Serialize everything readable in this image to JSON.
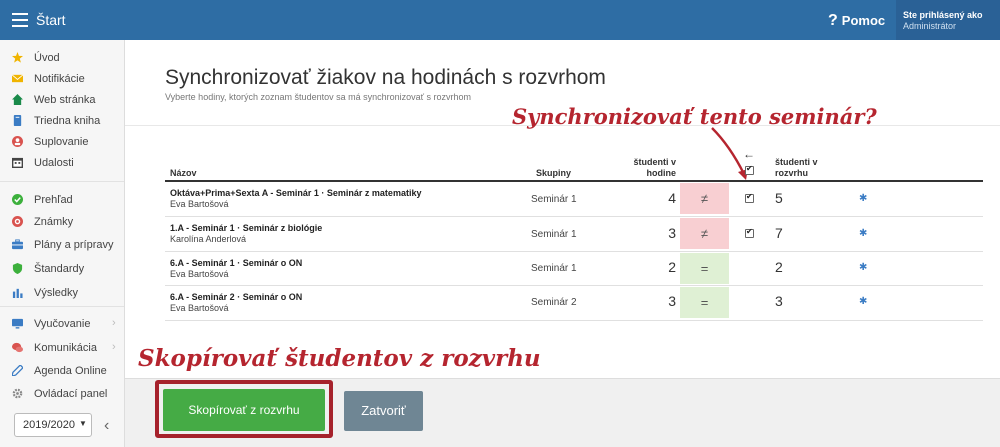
{
  "topbar": {
    "title": "Štart",
    "help_label": "Pomoc",
    "user_line1": "Ste prihlásený ako",
    "user_line2": "Administrátor"
  },
  "sidebar": {
    "items": [
      {
        "label": "Úvod",
        "icon": "star-icon",
        "color": "#f0b400"
      },
      {
        "label": "Notifikácie",
        "icon": "envelope-icon",
        "color": "#f0b400"
      },
      {
        "label": "Web stránka",
        "icon": "home-icon",
        "color": "#1a8a4a"
      },
      {
        "label": "Triedna kniha",
        "icon": "book-icon",
        "color": "#3b7cc4"
      },
      {
        "label": "Suplovanie",
        "icon": "user-icon",
        "color": "#d9534f"
      },
      {
        "label": "Udalosti",
        "icon": "calendar-icon",
        "color": "#444444"
      },
      {
        "label": "Prehľad",
        "icon": "check-circle-icon",
        "color": "#3cb03c"
      },
      {
        "label": "Známky",
        "icon": "target-icon",
        "color": "#d9534f"
      },
      {
        "label": "Plány a prípravy",
        "icon": "briefcase-icon",
        "color": "#3b7cc4"
      },
      {
        "label": "Štandardy",
        "icon": "shield-icon",
        "color": "#3cb03c"
      },
      {
        "label": "Výsledky",
        "icon": "bar-chart-icon",
        "color": "#3b7cc4"
      },
      {
        "label": "Vyučovanie",
        "icon": "monitor-icon",
        "color": "#3b7cc4"
      },
      {
        "label": "Komunikácia",
        "icon": "chat-icon",
        "color": "#d9534f"
      },
      {
        "label": "Agenda Online",
        "icon": "pencil-icon",
        "color": "#3b7cc4"
      },
      {
        "label": "Ovládací panel",
        "icon": "gear-icon",
        "color": "#888888"
      }
    ],
    "year": "2019/2020"
  },
  "main": {
    "title": "Synchronizovať žiakov na hodinách s rozvrhom",
    "subtitle": "Vyberte hodiny, ktorých zoznam študentov sa má synchronizovať s rozvrhom"
  },
  "table": {
    "headers": {
      "name": "Názov",
      "groups": "Skupiny",
      "students_hour_1": "študenti v",
      "students_hour_2": "hodine",
      "students_sched_1": "študenti v",
      "students_sched_2": "rozvrhu"
    },
    "rows": [
      {
        "course": "Oktáva+Prima+Sexta A - Seminár 1 · Seminár z matematiky",
        "teacher": "Eva Bartošová",
        "group": "Seminár 1",
        "hour_count": "4",
        "compare": "≠",
        "checked": true,
        "sched_count": "5"
      },
      {
        "course": "1.A - Seminár 1 · Seminár z biológie",
        "teacher": "Karolína Anderlová",
        "group": "Seminár 1",
        "hour_count": "3",
        "compare": "≠",
        "checked": true,
        "sched_count": "7"
      },
      {
        "course": "6.A - Seminár 1 · Seminár o ON",
        "teacher": "Eva Bartošová",
        "group": "Seminár 1",
        "hour_count": "2",
        "compare": "=",
        "checked": false,
        "sched_count": "2"
      },
      {
        "course": "6.A - Seminár 2 · Seminár o ON",
        "teacher": "Eva Bartošová",
        "group": "Seminár 2",
        "hour_count": "3",
        "compare": "=",
        "checked": false,
        "sched_count": "3"
      }
    ]
  },
  "annotations": {
    "top": "Synchronizovať tento seminár?",
    "bottom": "Skopírovať študentov z rozvrhu",
    "color": "#b5252f"
  },
  "footer": {
    "primary_label": "Skopírovať z rozvrhu",
    "secondary_label": "Zatvoriť"
  }
}
